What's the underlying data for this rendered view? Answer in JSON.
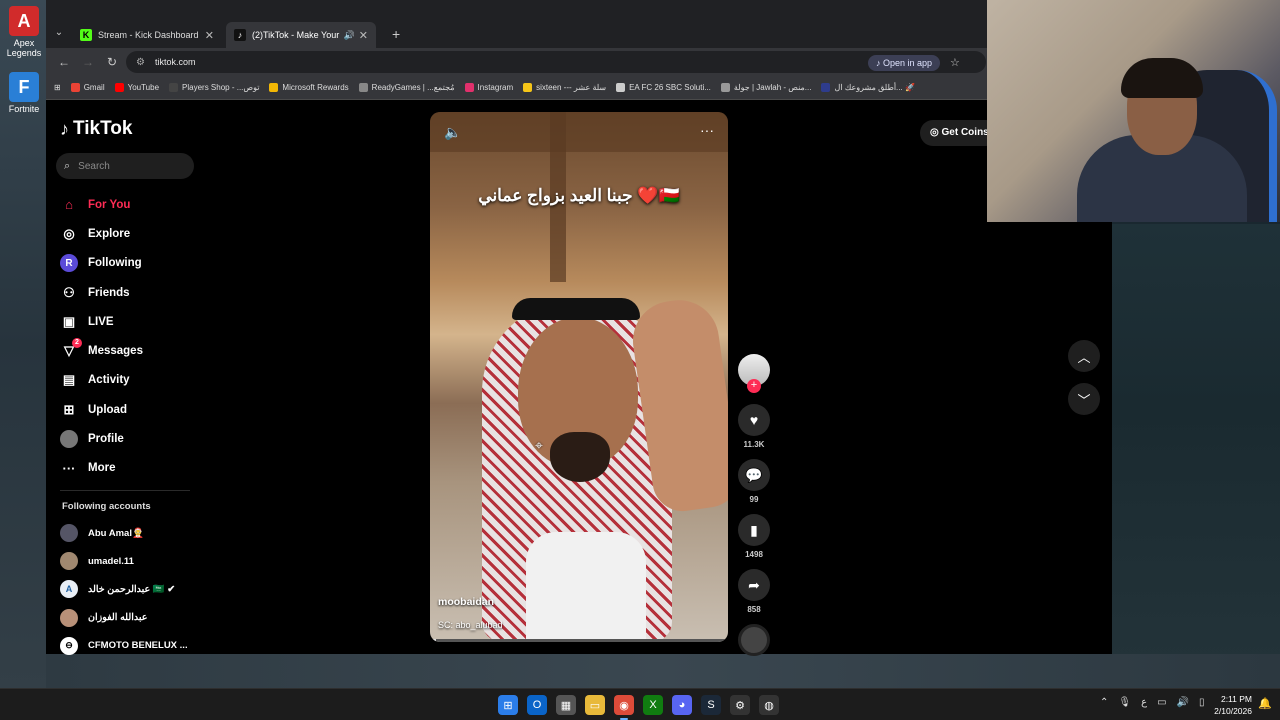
{
  "desktop": {
    "icons": [
      {
        "label": "Apex Legends",
        "glyph": "A",
        "color": "#d12b2b"
      },
      {
        "label": "Fortnite",
        "glyph": "F",
        "color": "#2a7fd6"
      }
    ]
  },
  "browser": {
    "tabs": [
      {
        "title": "Stream - Kick Dashboard",
        "favicon": "K",
        "favicon_color": "#53fc18",
        "active": false
      },
      {
        "title": "(2)TikTok - Make Your Day",
        "favicon": "♪",
        "favicon_color": "#111111",
        "active": true
      }
    ],
    "url": "tiktok.com",
    "open_in_app": "Open in app",
    "bookmarks": [
      {
        "label": "Gmail",
        "color": "#ea4335"
      },
      {
        "label": "YouTube",
        "color": "#ff0000"
      },
      {
        "label": "Players Shop - ...توص",
        "color": "#444444"
      },
      {
        "label": "Microsoft Rewards",
        "color": "#f2b705"
      },
      {
        "label": "ReadyGames | ...مُجتمع",
        "color": "#888888"
      },
      {
        "label": "Instagram",
        "color": "#e1306c"
      },
      {
        "label": "sixteen --- سلة عشر",
        "color": "#f5c518"
      },
      {
        "label": "EA FC 26 SBC Soluti...",
        "color": "#cccccc"
      },
      {
        "label": "جولة | Jawlah - منص...",
        "color": "#999999"
      },
      {
        "label": "أطلق مشروعك ال... 🚀",
        "color": "#2e3c8c"
      }
    ]
  },
  "tiktok": {
    "logo": "TikTok",
    "search_placeholder": "Search",
    "nav": [
      {
        "label": "For You",
        "icon": "home-icon",
        "glyph": "⌂",
        "active": true
      },
      {
        "label": "Explore",
        "icon": "compass-icon",
        "glyph": "◎",
        "active": false
      },
      {
        "label": "Following",
        "icon": "following-icon",
        "glyph": "R",
        "active": false
      },
      {
        "label": "Friends",
        "icon": "friends-icon",
        "glyph": "👥",
        "active": false
      },
      {
        "label": "LIVE",
        "icon": "live-icon",
        "glyph": "▣",
        "active": false
      },
      {
        "label": "Messages",
        "icon": "messages-icon",
        "glyph": "➤",
        "active": false,
        "badge": "2"
      },
      {
        "label": "Activity",
        "icon": "activity-icon",
        "glyph": "▤",
        "active": false
      },
      {
        "label": "Upload",
        "icon": "upload-icon",
        "glyph": "⊞",
        "active": false
      },
      {
        "label": "Profile",
        "icon": "profile-icon",
        "glyph": "●",
        "active": false
      },
      {
        "label": "More",
        "icon": "more-icon",
        "glyph": "···",
        "active": false
      }
    ],
    "following_title": "Following accounts",
    "following": [
      {
        "name": "Abu Amal🤶"
      },
      {
        "name": "umadel.11"
      },
      {
        "name": "عبدالرحمن خالد 🇸🇦 ✔"
      },
      {
        "name": "عبدالله الفوزان"
      },
      {
        "name": "CFMOTO BENELUX ..."
      }
    ],
    "get_coins": "Get Coins",
    "video": {
      "caption": "جبنا العيد بزواج عماني ❤️🇴🇲",
      "author": "moobaidan",
      "sound": "SC: abo_alubad",
      "progress": 0.02
    },
    "actions": {
      "likes": "11.3K",
      "comments": "99",
      "saves": "1498",
      "shares": "858"
    }
  },
  "taskbar": {
    "time": "2:11 PM",
    "date": "2/10/2026",
    "lang": "ع"
  }
}
